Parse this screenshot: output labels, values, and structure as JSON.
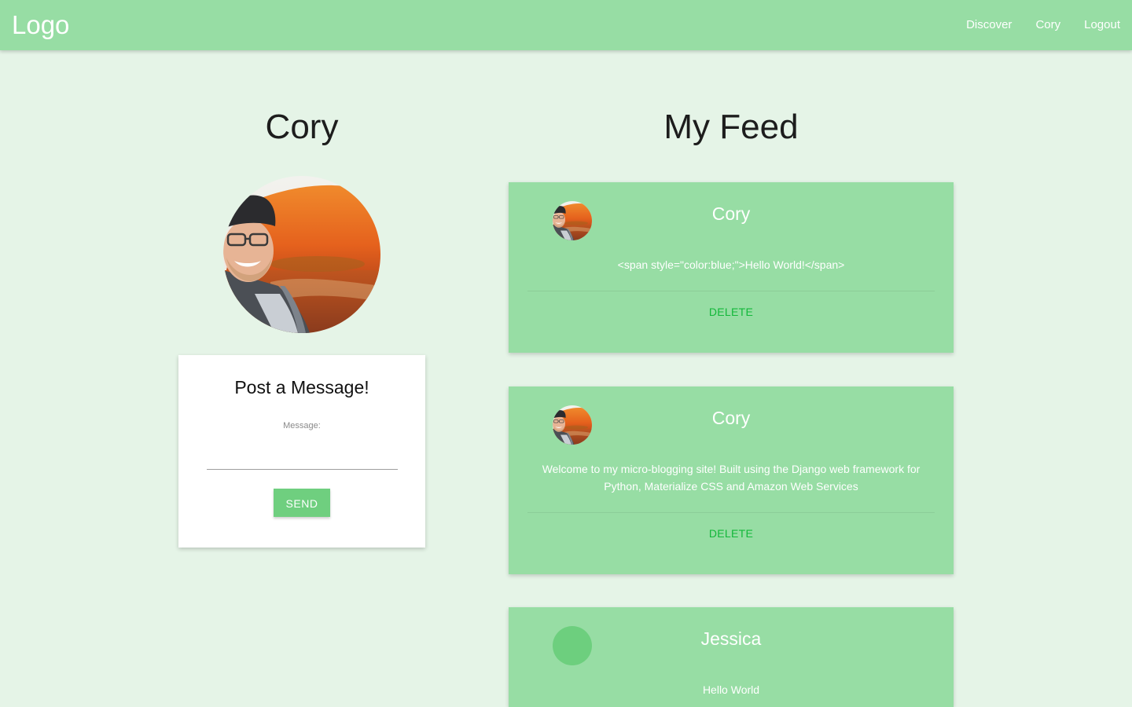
{
  "navbar": {
    "logo": "Logo",
    "links": [
      "Discover",
      "Cory",
      "Logout"
    ]
  },
  "profile": {
    "name": "Cory"
  },
  "post_form": {
    "title": "Post a Message!",
    "message_label": "Message:",
    "message_value": "",
    "send_label": "SEND"
  },
  "feed": {
    "title": "My Feed",
    "posts": [
      {
        "author": "Cory",
        "body": "<span style=\"color:blue;\">Hello World!</span>",
        "delete_label": "DELETE"
      },
      {
        "author": "Cory",
        "body": "Welcome to my micro-blogging site! Built using the Django web framework for Python, Materialize CSS and Amazon Web Services",
        "delete_label": "DELETE"
      },
      {
        "author": "Jessica",
        "body": "Hello World"
      }
    ]
  },
  "colors": {
    "navbar": "#97dda4",
    "background": "#e5f4e7",
    "card": "#97dda4",
    "button": "#6fcf7f",
    "delete": "#13b83a",
    "placeholder_avatar": "#6dcf7e"
  }
}
